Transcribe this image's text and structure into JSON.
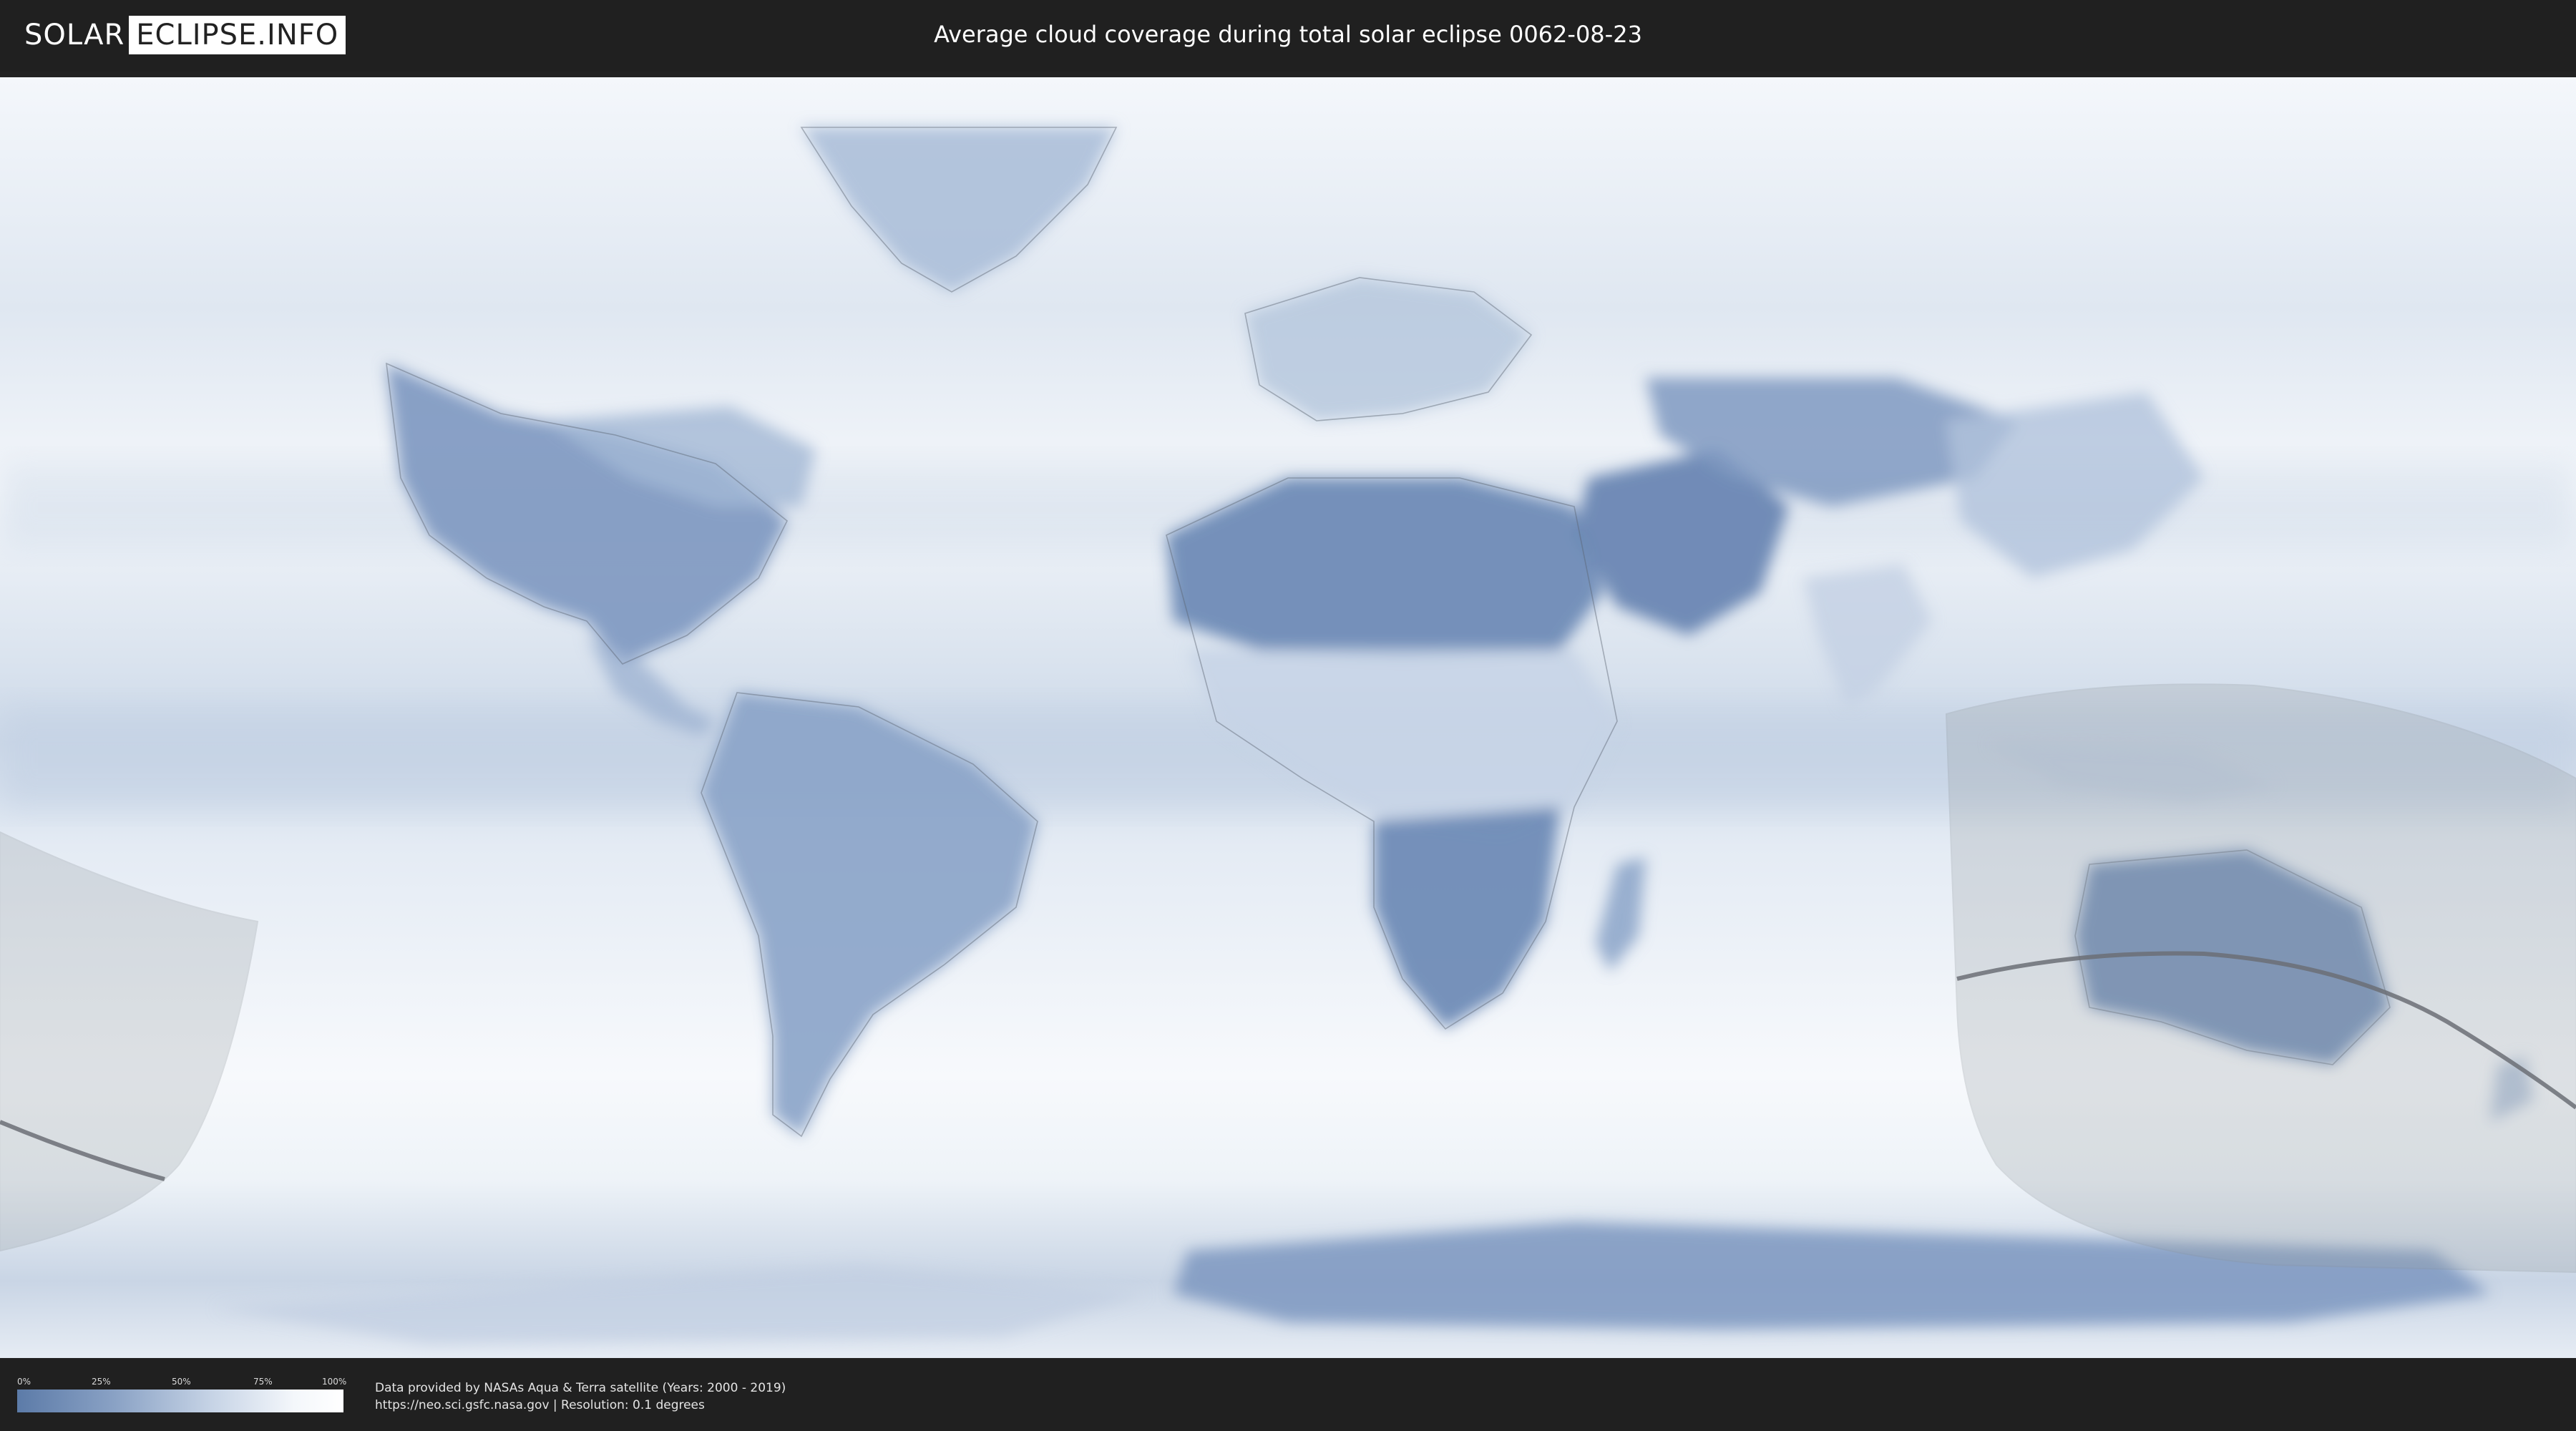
{
  "header": {
    "logo_part1": "SOLAR",
    "logo_part2": "ECLIPSE.INFO",
    "title": "Average cloud coverage during total solar eclipse 0062-08-23"
  },
  "legend": {
    "ticks": [
      "0%",
      "25%",
      "50%",
      "75%",
      "100%"
    ],
    "colors": {
      "low": "#5c7ba8",
      "high": "#ffffff"
    }
  },
  "credits": {
    "line1": "Data provided by NASAs Aqua & Terra satellite (Years: 2000 - 2019)",
    "line2": "https://neo.sci.gsfc.nasa.gov | Resolution: 0.1 degrees"
  },
  "map": {
    "colors": {
      "ocean_clouds": "#eef3f8",
      "clear_land": "#6a87b3",
      "shadow_zone": "#9aa0a6",
      "central_line": "#6b6f74",
      "borders": "#5a6470"
    }
  }
}
